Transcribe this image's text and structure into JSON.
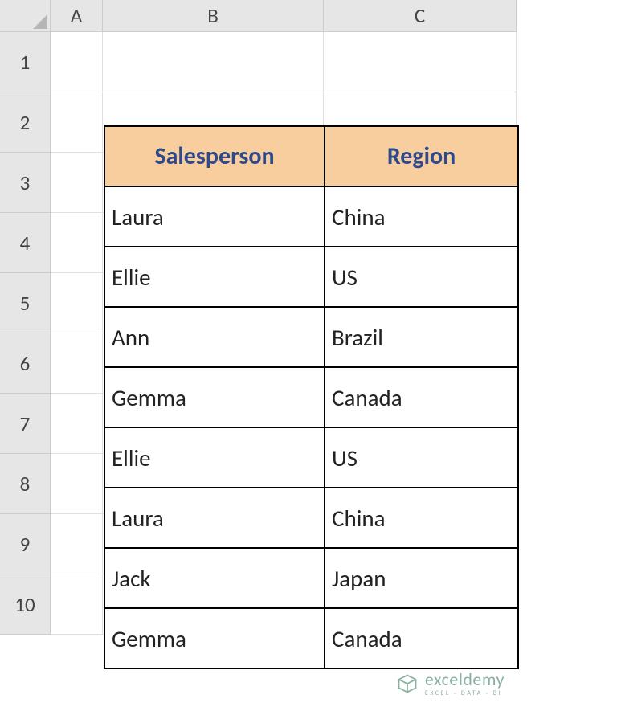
{
  "columns": [
    "A",
    "B",
    "C"
  ],
  "rows": [
    "1",
    "2",
    "3",
    "4",
    "5",
    "6",
    "7",
    "8",
    "9",
    "10"
  ],
  "table": {
    "headers": {
      "col_b": "Salesperson",
      "col_c": "Region"
    },
    "data": [
      {
        "salesperson": "Laura",
        "region": "China"
      },
      {
        "salesperson": "Ellie",
        "region": "US"
      },
      {
        "salesperson": "Ann",
        "region": "Brazil"
      },
      {
        "salesperson": "Gemma",
        "region": "Canada"
      },
      {
        "salesperson": "Ellie",
        "region": "US"
      },
      {
        "salesperson": "Laura",
        "region": "China"
      },
      {
        "salesperson": "Jack",
        "region": "Japan"
      },
      {
        "salesperson": "Gemma",
        "region": "Canada"
      }
    ]
  },
  "watermark": {
    "brand": "exceldemy",
    "tagline": "EXCEL · DATA · BI"
  }
}
